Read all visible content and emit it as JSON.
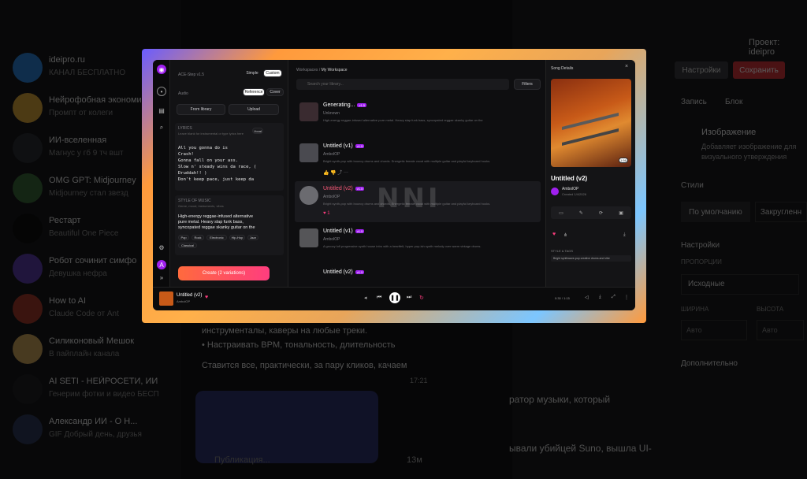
{
  "background": {
    "chats": [
      {
        "title": "ideipro.ru",
        "sub": "КАНАЛ БЕСПЛАТНО",
        "color": "#2a7fd1"
      },
      {
        "title": "Нейрофобная экономика",
        "sub": "Промпт от колеги",
        "color": "#d7a33a"
      },
      {
        "title": "ИИ-вселенная",
        "sub": "Магнус у гб 9 тч вшт",
        "color": "#2c2f34"
      },
      {
        "title": "OMG GPT: Midjourney",
        "sub": "Midjourney стал звезд",
        "color": "#3b6a3a"
      },
      {
        "title": "Рестарт",
        "sub": "Beautiful One Piece",
        "color": "#101010"
      },
      {
        "title": "Робот сочинит симфо",
        "sub": "Девушка нефра",
        "color": "#5a3ca7"
      },
      {
        "title": "How to AI",
        "sub": "Claude Code от Ant",
        "color": "#a33a2a"
      },
      {
        "title": "Силиконовый Мешок",
        "sub": "В пайплайн канала",
        "color": "#caa15a"
      },
      {
        "title": "AI SETI - НЕЙРОСЕТИ, ИИ",
        "sub": "Генерим фотки и видео БЕСП",
        "color": "#1f1f22"
      },
      {
        "title": "Александр ИИ - О Н...",
        "sub": "GIF Добрый день, друзья",
        "color": "#2f3a5a"
      }
    ],
    "chat_text_lines": [
      "инструменталы, каверы на любые треки.",
      "• Настраивать BPM, тональность, длительность",
      "Ставится все, практически, за пару кликов, качаем"
    ],
    "chat_time": "17:21",
    "chat_input_placeholder": "Публикация...",
    "chat_count": "13м",
    "right": {
      "title": "Проект: ideipro",
      "btn_settings": "Настройки",
      "btn_save": "Сохранить",
      "tab_post": "Запись",
      "tab_block": "Блок",
      "section_image": "Изображение",
      "image_desc": "Добавляет изображение для визуального утверждения",
      "styles": "Стили",
      "style_default": "По умолчанию",
      "style_rounded": "Закругленн",
      "settings": "Настройки",
      "proportions": "ПРОПОРЦИИ",
      "proportions_value": "Исходные",
      "width": "ШИРИНА",
      "height": "ВЫСОТА",
      "auto": "Авто",
      "px": "px",
      "extra": "Дополнительно",
      "bottom_text1": "ратор музыки, который",
      "bottom_text2": "ывали убийцей Suno, вышла UI-"
    }
  },
  "app": {
    "rail": {
      "logo": "◉"
    },
    "panel": {
      "model": "ACE-Step v1.5",
      "tab_simple": "Simple",
      "tab_custom": "Custom",
      "audio_label": "Audio",
      "reference": "Reference",
      "cover": "Cover",
      "from_library": "From library",
      "upload": "Upload",
      "lyrics_label": "LYRICS",
      "lyrics_hint": "Leave blank for instrumental or type lyrics here",
      "lyrics_tag": "Vocal",
      "lyrics": [
        "All you gonna do is",
        "Crash!",
        "Gonna fall on your ass.",
        "Slow n' steady wins da race, (",
        "Druddah!! )",
        "Don't keep pace, just keep da"
      ],
      "style_label": "STYLE OF MUSIC",
      "style_hint": "Genre, mood, instruments, vibes",
      "style_text": [
        "High-energy reggae-infused alternative",
        "pure metal. Heavy slap funk bass,",
        "syncopated reggae skanky guitar on the"
      ],
      "chips": [
        "Pop",
        "Rock",
        "Electronic",
        "Hip-Hop",
        "Jazz",
        "Classical"
      ],
      "create_btn": "Create (2 variations)"
    },
    "main": {
      "breadcrumb_root": "Workspaces",
      "breadcrumb_sep": "/",
      "breadcrumb_current": "My Workspace",
      "search_placeholder": "Search your library...",
      "filters": "Filters",
      "songs": [
        {
          "title": "Generating...",
          "tag": "v1.5",
          "author": "Unknown",
          "desc": "High-energy reggae-infused alternative pure metal. Heavy slap funk bass, syncopated reggae skanky guitar on the",
          "thumb": "#3a2b30"
        },
        {
          "title": "Untitled (v1)",
          "tag": "v1.5",
          "author": "AmbolOP",
          "desc": "Bright synth-pop with bouncy drums and chords. Energetic female vocal with multiple guitar and playful keyboard hooks.",
          "thumb": "#4a4a50",
          "likes": "",
          "time": "3:15"
        },
        {
          "title": "Untitled (v2)",
          "tag": "v1.5",
          "author": "AmbolOP",
          "desc": "Bright synth-pop with bouncy drums and chords. Energetic female vocal with multiple guitar and playful keyboard hooks.",
          "thumb": "#6b6b70",
          "likes": "1",
          "time": "3:15"
        },
        {
          "title": "Untitled (v1)",
          "tag": "v1.5",
          "author": "AmbolOP",
          "desc": "A groovy lofi progressive synth house intro with a heartfelt, hyper pop-ish synth melody over warm vintage drums.",
          "thumb": "#555558"
        },
        {
          "title": "Untitled (v2)",
          "tag": "v1.5",
          "author": "AmbolOP",
          "desc": "",
          "thumb": "#444448"
        }
      ]
    },
    "details": {
      "header": "Song Details",
      "title": "Untitled (v2)",
      "author": "AmbolOP",
      "created": "Created 1/4/2026",
      "duration_badge": "1:56",
      "style_tags": "STYLE & TAGS",
      "style_text": "Bright synthwave-pop creative drums and vibe"
    },
    "player": {
      "title": "Untitled (v2)",
      "author": "AmbolOP",
      "time": "0:30 / 1:15",
      "heart_color": "#ff3d7f"
    },
    "watermark": "NNI"
  }
}
